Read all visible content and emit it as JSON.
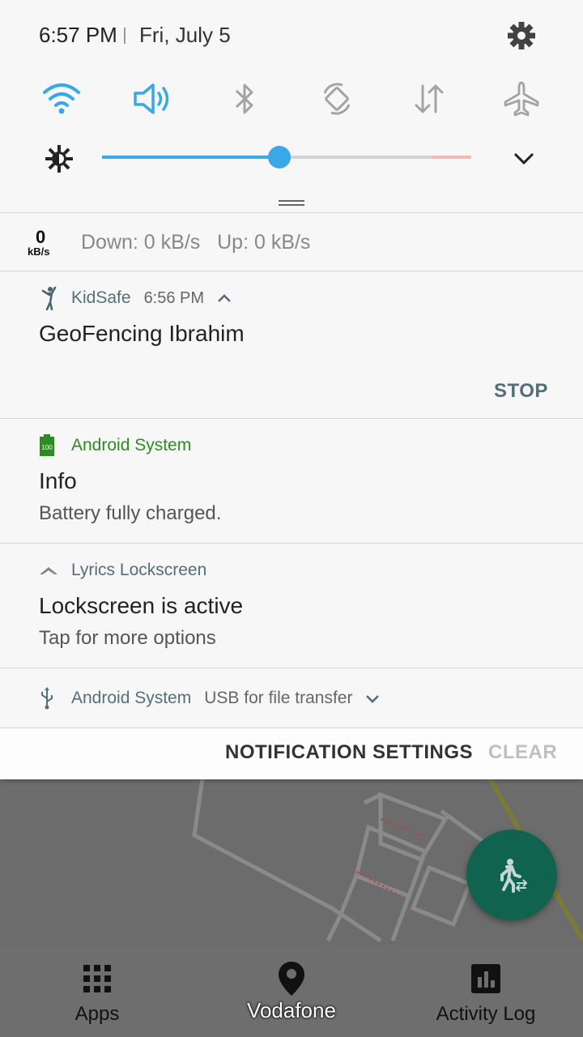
{
  "status": {
    "time": "6:57 PM",
    "date": "Fri, July 5"
  },
  "quick_settings": [
    {
      "name": "wifi-icon",
      "active": true
    },
    {
      "name": "sound-icon",
      "active": true
    },
    {
      "name": "bluetooth-icon",
      "active": false
    },
    {
      "name": "auto-rotate-icon",
      "active": false
    },
    {
      "name": "mobile-data-icon",
      "active": false
    },
    {
      "name": "airplane-mode-icon",
      "active": false
    }
  ],
  "brightness": {
    "level_percent": 48
  },
  "netspeed": {
    "value": "0",
    "unit": "kB/s",
    "text": "Down: 0 kB/s   Up: 0 kB/s"
  },
  "notifications": {
    "kidsafe": {
      "app": "KidSafe",
      "time": "6:56 PM",
      "title": "GeoFencing Ibrahim",
      "action": "STOP"
    },
    "battery": {
      "app": "Android System",
      "badge": "100",
      "title": "Info",
      "text": "Battery fully charged."
    },
    "lyrics": {
      "app": "Lyrics Lockscreen",
      "title": "Lockscreen is active",
      "text": "Tap for more options"
    },
    "usb": {
      "app": "Android System",
      "text": "USB for file transfer"
    }
  },
  "footer": {
    "settings_label": "NOTIFICATION SETTINGS",
    "clear_label": "CLEAR"
  },
  "bottom_nav": {
    "apps": "Apps",
    "activity_log": "Activity Log"
  },
  "toast": "Vodafone",
  "colors": {
    "accent": "#3aa7e6",
    "android_green": "#2e8b24",
    "fab": "#10634e",
    "action": "#546e7a"
  }
}
